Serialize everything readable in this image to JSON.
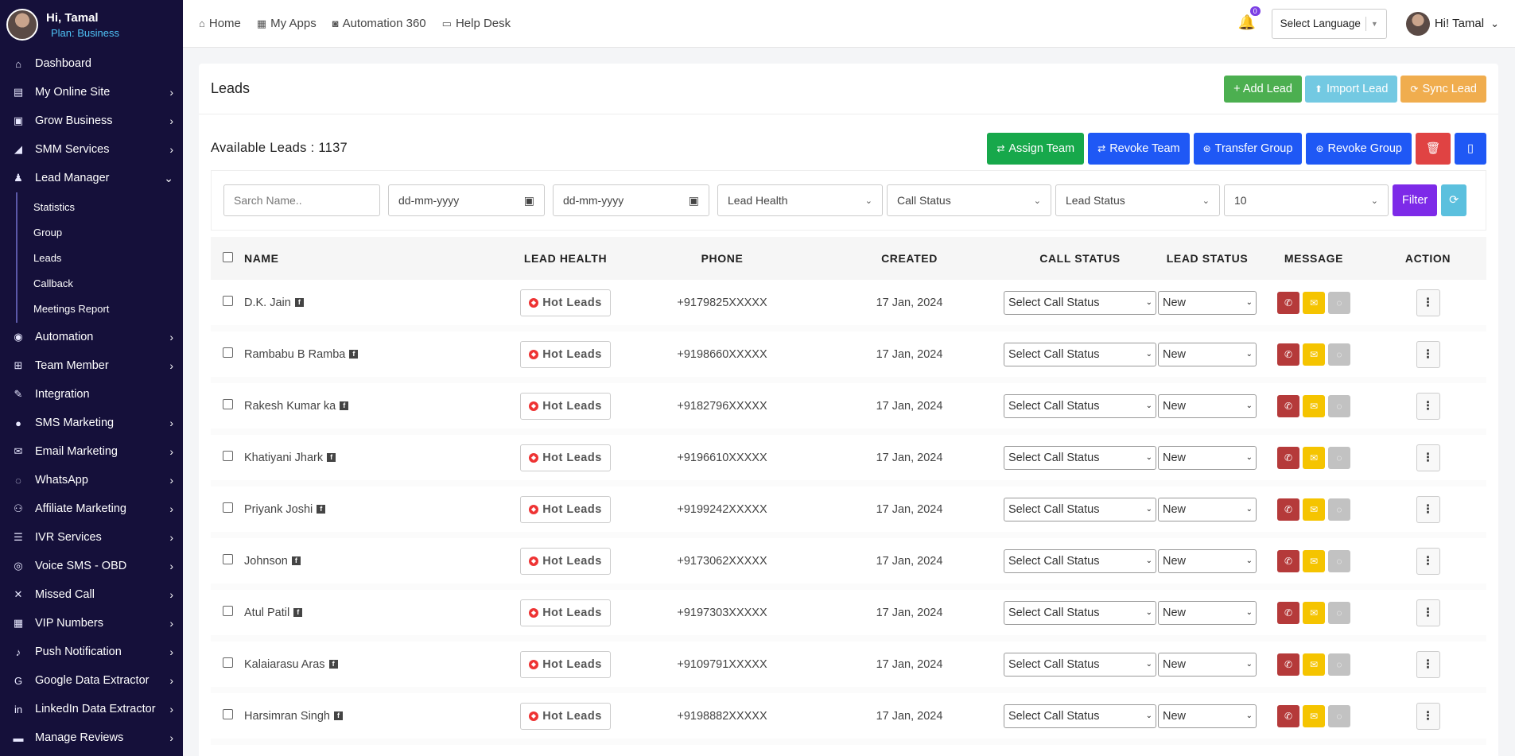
{
  "sidebar": {
    "greeting": "Hi, Tamal",
    "plan": "Plan: Business",
    "items": [
      {
        "label": "Dashboard",
        "icon": "home-icon",
        "glyph": "⌂",
        "chevron": ""
      },
      {
        "label": "My Online Site",
        "icon": "server-icon",
        "glyph": "▤",
        "chevron": "›"
      },
      {
        "label": "Grow Business",
        "icon": "id-card-icon",
        "glyph": "▣",
        "chevron": "›"
      },
      {
        "label": "SMM Services",
        "icon": "bullhorn-icon",
        "glyph": "◢",
        "chevron": "›"
      },
      {
        "label": "Lead Manager",
        "icon": "users-icon",
        "glyph": "♟",
        "chevron": "⌄"
      }
    ],
    "sub_items": [
      "Statistics",
      "Group",
      "Leads",
      "Callback",
      "Meetings Report"
    ],
    "items2": [
      {
        "label": "Automation",
        "icon": "robot-icon",
        "glyph": "◉",
        "chevron": "›"
      },
      {
        "label": "Team Member",
        "icon": "sitemap-icon",
        "glyph": "⊞",
        "chevron": "›"
      },
      {
        "label": "Integration",
        "icon": "plug-icon",
        "glyph": "✎",
        "chevron": ""
      },
      {
        "label": "SMS Marketing",
        "icon": "comment-icon",
        "glyph": "●",
        "chevron": "›"
      },
      {
        "label": "Email Marketing",
        "icon": "envelope-icon",
        "glyph": "✉",
        "chevron": "›"
      },
      {
        "label": "WhatsApp",
        "icon": "whatsapp-icon",
        "glyph": "◌",
        "chevron": "›"
      },
      {
        "label": "Affiliate Marketing",
        "icon": "users-group-icon",
        "glyph": "⚇",
        "chevron": "›"
      },
      {
        "label": "IVR Services",
        "icon": "list-icon",
        "glyph": "☰",
        "chevron": "›"
      },
      {
        "label": "Voice SMS - OBD",
        "icon": "broadcast-icon",
        "glyph": "◎",
        "chevron": "›"
      },
      {
        "label": "Missed Call",
        "icon": "tools-icon",
        "glyph": "✕",
        "chevron": "›"
      },
      {
        "label": "VIP Numbers",
        "icon": "address-book-icon",
        "glyph": "▦",
        "chevron": "›"
      },
      {
        "label": "Push Notification",
        "icon": "bell-icon",
        "glyph": "♪",
        "chevron": "›"
      },
      {
        "label": "Google Data Extractor",
        "icon": "google-icon",
        "glyph": "G",
        "chevron": "›"
      },
      {
        "label": "LinkedIn Data Extractor",
        "icon": "linkedin-icon",
        "glyph": "in",
        "chevron": "›"
      },
      {
        "label": "Manage Reviews",
        "icon": "comment-alt-icon",
        "glyph": "▬",
        "chevron": "›"
      }
    ]
  },
  "topbar": {
    "links": [
      {
        "label": "Home",
        "glyph": "⌂"
      },
      {
        "label": "My Apps",
        "glyph": "▦"
      },
      {
        "label": "Automation 360",
        "glyph": "◙"
      },
      {
        "label": "Help Desk",
        "glyph": "▭"
      }
    ],
    "notif_count": "0",
    "language": "Select Language",
    "user": "Hi! Tamal"
  },
  "leads": {
    "title": "Leads",
    "add": "+ Add Lead",
    "import": "Import Lead",
    "sync": "Sync Lead",
    "available": "Available Leads : 1137",
    "assign": "Assign Team",
    "revoke": "Revoke Team",
    "transfer": "Transfer Group",
    "revoke_group": "Revoke Group"
  },
  "filters": {
    "search_placeholder": "Sarch Name..",
    "date_from": "dd-mm-yyyy",
    "date_to": "dd-mm-yyyy",
    "lead_health": "Lead Health",
    "call_status": "Call Status",
    "lead_status": "Lead Status",
    "per_page": "10",
    "filter": "Filter"
  },
  "table": {
    "headers": [
      "NAME",
      "LEAD HEALTH",
      "PHONE",
      "CREATED",
      "CALL STATUS",
      "LEAD STATUS",
      "MESSAGE",
      "ACTION"
    ],
    "rows": [
      {
        "name": "D.K. Jain",
        "health": "Hot Leads",
        "phone": "+9179825XXXXX",
        "created": "17 Jan, 2024",
        "call_status": "Select Call Status",
        "lead_status": "New"
      },
      {
        "name": "Rambabu B Ramba",
        "health": "Hot Leads",
        "phone": "+9198660XXXXX",
        "created": "17 Jan, 2024",
        "call_status": "Select Call Status",
        "lead_status": "New"
      },
      {
        "name": "Rakesh Kumar ka",
        "health": "Hot Leads",
        "phone": "+9182796XXXXX",
        "created": "17 Jan, 2024",
        "call_status": "Select Call Status",
        "lead_status": "New"
      },
      {
        "name": "Khatiyani Jhark",
        "health": "Hot Leads",
        "phone": "+9196610XXXXX",
        "created": "17 Jan, 2024",
        "call_status": "Select Call Status",
        "lead_status": "New"
      },
      {
        "name": "Priyank Joshi",
        "health": "Hot Leads",
        "phone": "+9199242XXXXX",
        "created": "17 Jan, 2024",
        "call_status": "Select Call Status",
        "lead_status": "New"
      },
      {
        "name": "Johnson",
        "health": "Hot Leads",
        "phone": "+9173062XXXXX",
        "created": "17 Jan, 2024",
        "call_status": "Select Call Status",
        "lead_status": "New"
      },
      {
        "name": "Atul Patil",
        "health": "Hot Leads",
        "phone": "+9197303XXXXX",
        "created": "17 Jan, 2024",
        "call_status": "Select Call Status",
        "lead_status": "New"
      },
      {
        "name": "Kalaiarasu Aras",
        "health": "Hot Leads",
        "phone": "+9109791XXXXX",
        "created": "17 Jan, 2024",
        "call_status": "Select Call Status",
        "lead_status": "New"
      },
      {
        "name": "Harsimran Singh",
        "health": "Hot Leads",
        "phone": "+9198882XXXXX",
        "created": "17 Jan, 2024",
        "call_status": "Select Call Status",
        "lead_status": "New"
      }
    ]
  }
}
